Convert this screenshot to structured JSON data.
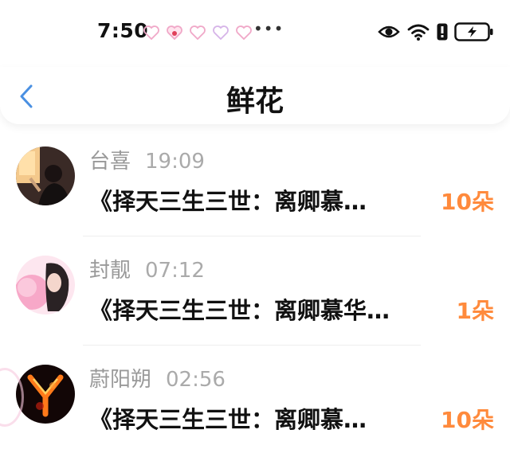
{
  "status_bar": {
    "time": "7:50",
    "more": "•••",
    "notification_icons": [
      "heart-icon",
      "heart-badge-icon",
      "heart-icon",
      "heart-icon",
      "heart-icon"
    ],
    "system_icons": [
      "eye-icon",
      "wifi-icon",
      "alert-icon",
      "battery-icon"
    ]
  },
  "header": {
    "title": "鲜花",
    "back_icon": "chevron-left-icon"
  },
  "colors": {
    "accent": "#ff8a3c",
    "back": "#4a90e2",
    "muted": "#999999"
  },
  "messages": [
    {
      "name": "台喜",
      "time": "19:09",
      "text": "《择天三生三世：离卿慕…",
      "count": "10朵"
    },
    {
      "name": "封靓",
      "time": "07:12",
      "text": "《择天三生三世：离卿慕华…",
      "count": "1朵"
    },
    {
      "name": "蔚阳朔",
      "time": "02:56",
      "text": "《择天三生三世：离卿慕…",
      "count": "10朵"
    }
  ]
}
